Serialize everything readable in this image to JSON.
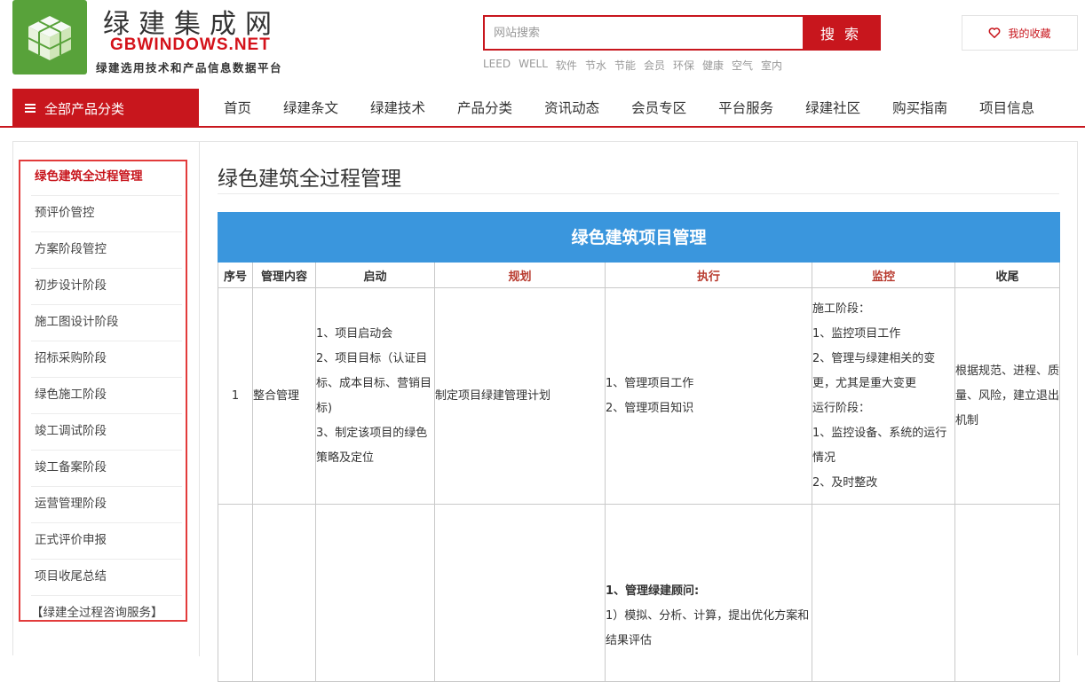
{
  "header": {
    "site_title": "绿建集成网",
    "site_domain": "GBWINDOWS.NET",
    "slogan": "绿建选用技术和产品信息数据平台",
    "logo_icon": "cube-logo-icon",
    "search": {
      "placeholder": "网站搜索",
      "button": "搜 索"
    },
    "hot_words": [
      "LEED",
      "WELL",
      "软件",
      "节水",
      "节能",
      "会员",
      "环保",
      "健康",
      "空气",
      "室内"
    ],
    "favorites": {
      "label": "我的收藏",
      "icon": "heart-icon"
    }
  },
  "nav": {
    "all_categories": "全部产品分类",
    "items": [
      "首页",
      "绿建条文",
      "绿建技术",
      "产品分类",
      "资讯动态",
      "会员专区",
      "平台服务",
      "绿建社区",
      "购买指南",
      "项目信息"
    ]
  },
  "sidebar": {
    "items": [
      "绿色建筑全过程管理",
      "预评价管控",
      "方案阶段管控",
      "初步设计阶段",
      "施工图设计阶段",
      "招标采购阶段",
      "绿色施工阶段",
      "竣工调试阶段",
      "竣工备案阶段",
      "运营管理阶段",
      "正式评价申报",
      "项目收尾总结"
    ],
    "service": "【绿建全过程咨询服务】"
  },
  "main": {
    "title": "绿色建筑全过程管理",
    "table": {
      "banner": "绿色建筑项目管理",
      "headers": [
        "序号",
        "管理内容",
        "启动",
        "规划",
        "执行",
        "监控",
        "收尾"
      ],
      "rows": [
        {
          "no": "1",
          "content": "整合管理",
          "start": [
            "1、项目启动会",
            "2、项目目标（认证目标、成本目标、营销目标)",
            "3、制定该项目的绿色策略及定位"
          ],
          "plan": "制定项目绿建管理计划",
          "exec": [
            "1、管理项目工作",
            "2、管理项目知识"
          ],
          "monitor": [
            "施工阶段：",
            "1、监控项目工作",
            "2、管理与绿建相关的变更，尤其是重大变更",
            "运行阶段：",
            "1、监控设备、系统的运行情况",
            "2、及时整改"
          ],
          "close": "根据规范、进程、质量、风险，建立退出机制"
        },
        {
          "exec_title": "1、管理绿建顾问:",
          "exec": [
            "1）模拟、分析、计算，提出优化方案和结果评估"
          ]
        }
      ]
    }
  },
  "colors": {
    "brand_red": "#c8161d",
    "banner_blue": "#3a96dd",
    "logo_green": "#58a23a"
  }
}
